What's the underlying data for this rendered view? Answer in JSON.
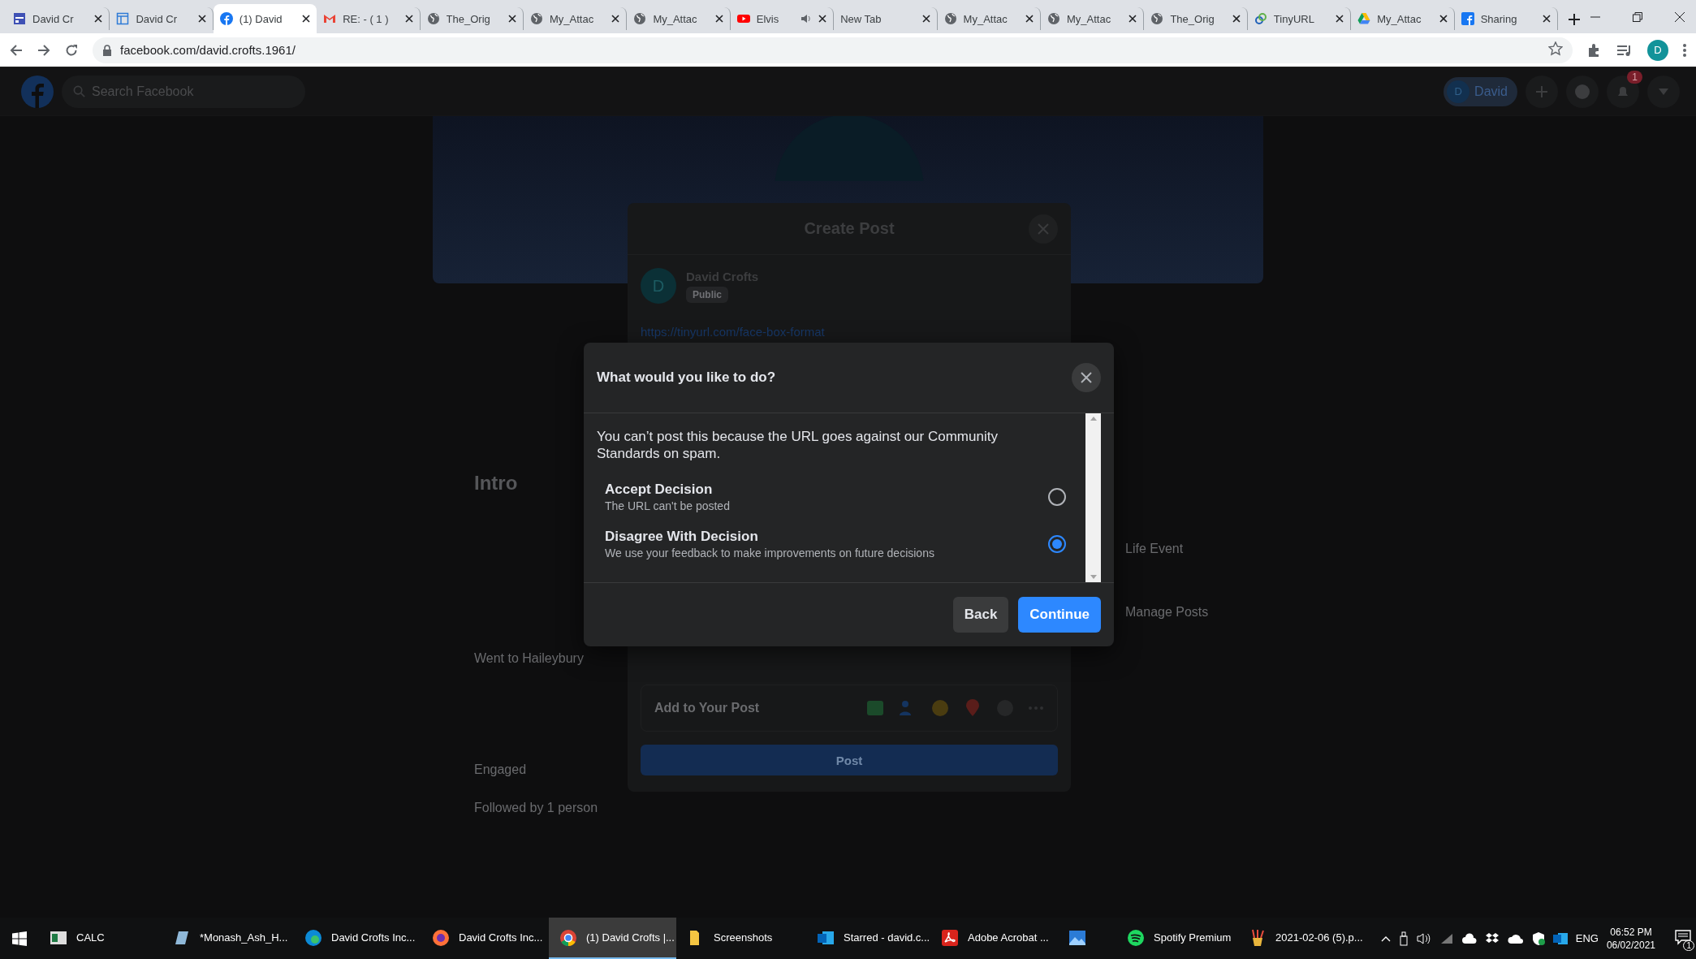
{
  "browser": {
    "tabs": [
      {
        "title": "David Cr",
        "kind": "calendar",
        "selected": false,
        "audio": false
      },
      {
        "title": "David Cr",
        "kind": "table",
        "selected": false,
        "audio": false
      },
      {
        "title": "(1) David",
        "kind": "facebook",
        "selected": true,
        "audio": false
      },
      {
        "title": "RE: - ( 1 )",
        "kind": "gmail",
        "selected": false,
        "audio": false
      },
      {
        "title": "The_Orig",
        "kind": "globe",
        "selected": false,
        "audio": false
      },
      {
        "title": "My_Attac",
        "kind": "globe",
        "selected": false,
        "audio": false
      },
      {
        "title": "My_Attac",
        "kind": "globe",
        "selected": false,
        "audio": false
      },
      {
        "title": "Elvis",
        "kind": "youtube",
        "selected": false,
        "audio": true
      },
      {
        "title": "New Tab",
        "kind": "blank",
        "selected": false,
        "audio": false
      },
      {
        "title": "My_Attac",
        "kind": "globe",
        "selected": false,
        "audio": false
      },
      {
        "title": "My_Attac",
        "kind": "globe",
        "selected": false,
        "audio": false
      },
      {
        "title": "The_Orig",
        "kind": "globe",
        "selected": false,
        "audio": false
      },
      {
        "title": "TinyURL",
        "kind": "link",
        "selected": false,
        "audio": false
      },
      {
        "title": "My_Attac",
        "kind": "drive",
        "selected": false,
        "audio": false
      },
      {
        "title": "Sharing",
        "kind": "facebook-square",
        "selected": false,
        "audio": false
      }
    ],
    "url": "facebook.com/david.crofts.1961/",
    "profile_initial": "D"
  },
  "facebook": {
    "search_placeholder": "Search Facebook",
    "profile_initial": "D",
    "profile_name": "David",
    "notification_count": "1",
    "intro_title": "Intro",
    "intro_items": [
      "Went to Haileybury",
      "Engaged",
      "Followed by 1 person"
    ],
    "side_actions": [
      "Life Event",
      "Manage Posts"
    ]
  },
  "create_post": {
    "title": "Create Post",
    "author_initial": "D",
    "author": "David Crofts",
    "audience": "Public",
    "text": "https://tinyurl.com/face-box-format",
    "add_label": "Add to Your Post",
    "post_button": "Post"
  },
  "dialog": {
    "title": "What would you like to do?",
    "message": "You can’t post this because the URL goes against our Community Standards on spam.",
    "options": [
      {
        "title": "Accept Decision",
        "description": "The URL can't be posted",
        "selected": false
      },
      {
        "title": "Disagree With Decision",
        "description": "We use your feedback to make improvements on future decisions",
        "selected": true
      }
    ],
    "buttons": [
      {
        "label": "Back",
        "kind": "secondary"
      },
      {
        "label": "Continue",
        "kind": "primary"
      }
    ]
  },
  "taskbar": {
    "items": [
      {
        "label": "CALC",
        "kind": "calc",
        "active": false
      },
      {
        "label": "*Monash_Ash_H...",
        "kind": "notepad",
        "active": false
      },
      {
        "label": "David Crofts Inc...",
        "kind": "edge",
        "active": false
      },
      {
        "label": "David Crofts Inc...",
        "kind": "firefox",
        "active": false
      },
      {
        "label": "(1) David Crofts |...",
        "kind": "chrome",
        "active": true
      },
      {
        "label": "Screenshots",
        "kind": "folder",
        "active": false
      },
      {
        "label": "Starred - david.c...",
        "kind": "outlook",
        "active": false
      },
      {
        "label": "Adobe Acrobat ...",
        "kind": "acrobat",
        "active": false
      },
      {
        "kind": "photos",
        "active": false
      },
      {
        "label": "Spotify Premium",
        "kind": "spotify",
        "active": false
      },
      {
        "label": "2021-02-06 (5).p...",
        "kind": "paint",
        "active": false
      }
    ],
    "language": "ENG",
    "time": "06:52 PM",
    "date": "06/02/2021",
    "notifications": "1"
  }
}
